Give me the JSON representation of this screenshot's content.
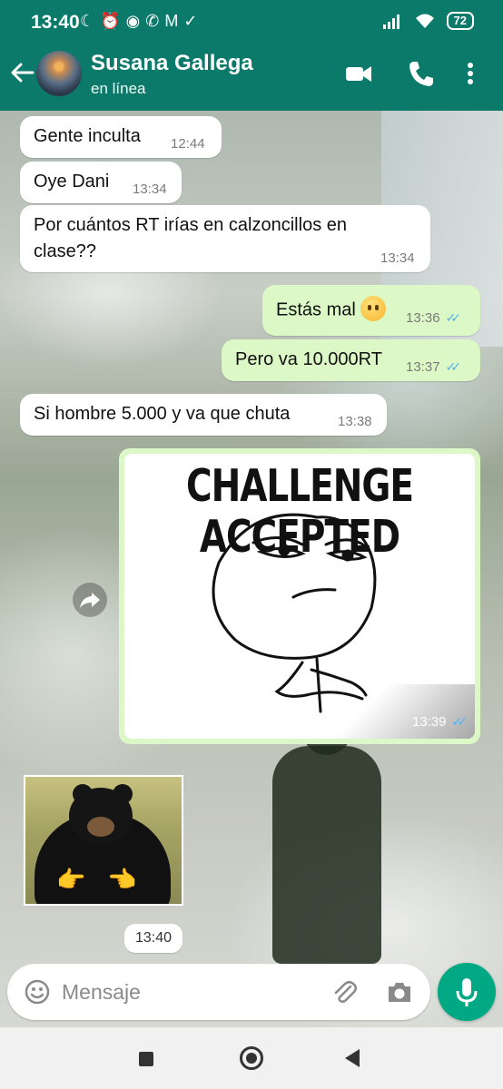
{
  "status_bar": {
    "time": "13:40",
    "battery": "72"
  },
  "header": {
    "contact_name": "Susana Gallega",
    "contact_status": "en línea"
  },
  "messages": [
    {
      "direction": "in",
      "text": "Gente inculta",
      "time": "12:44"
    },
    {
      "direction": "in",
      "text": "Oye Dani",
      "time": "13:34"
    },
    {
      "direction": "in",
      "text_line1": "Por cuántos RT irías en calzoncillos en",
      "text_line2": "clase??",
      "time": "13:34"
    },
    {
      "direction": "out",
      "text": "Estás mal",
      "time": "13:36",
      "read": true
    },
    {
      "direction": "out",
      "text": "Pero va 10.000RT",
      "time": "13:37",
      "read": true
    },
    {
      "direction": "in",
      "text": "Si hombre 5.000 y va que chuta",
      "time": "13:38"
    },
    {
      "direction": "out",
      "type": "image",
      "image_caption": "CHALLENGE ACCEPTED",
      "time": "13:39",
      "read": true
    },
    {
      "direction": "in",
      "type": "sticker",
      "time": "13:40"
    }
  ],
  "input": {
    "placeholder": "Mensaje"
  },
  "colors": {
    "header": "#0b7a6b",
    "outgoing_bubble": "#dcf8c6",
    "incoming_bubble": "#ffffff",
    "read_ticks": "#4fb3f6",
    "mic_button": "#00a884"
  }
}
